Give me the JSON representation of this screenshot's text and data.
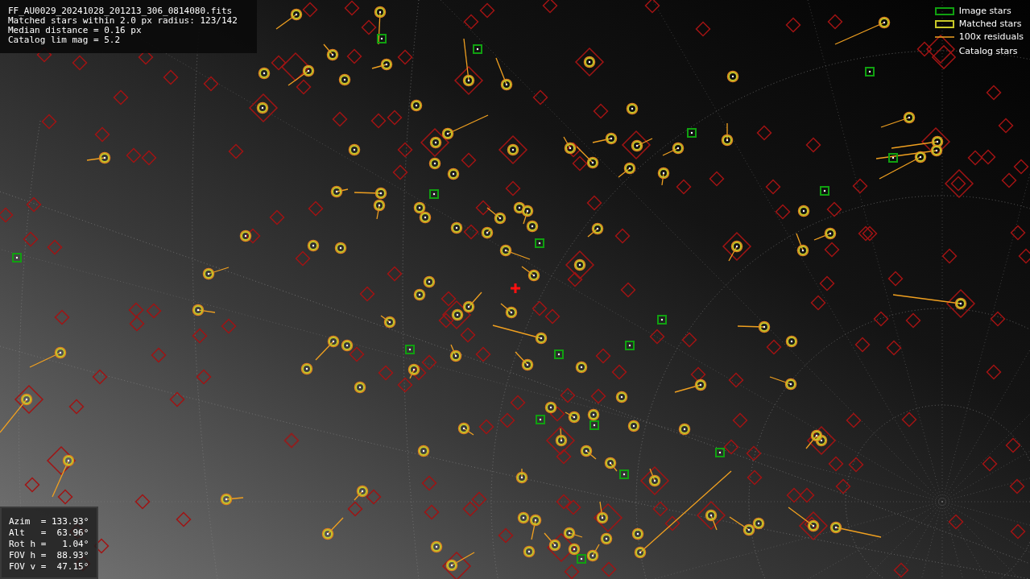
{
  "info": {
    "lines": [
      "FF_AU0029_20241028_201213_306_0814080.fits",
      "Matched stars within 2.0 px radius: 123/142",
      "Median distance = 0.16 px",
      "Catalog lim mag = 5.2"
    ]
  },
  "legend": [
    {
      "kind": "image",
      "label": "Image stars"
    },
    {
      "kind": "matched",
      "label": "Matched stars"
    },
    {
      "kind": "residual",
      "label": "100x residuals"
    },
    {
      "kind": "catalog",
      "label": "Catalog stars"
    }
  ],
  "pointing": {
    "lines": [
      "Azim  = 133.93°",
      "Alt   =  63.96°",
      "Rot h =   1.04°",
      "FOV h =  88.93°",
      "FOV v =  47.15°"
    ]
  }
}
